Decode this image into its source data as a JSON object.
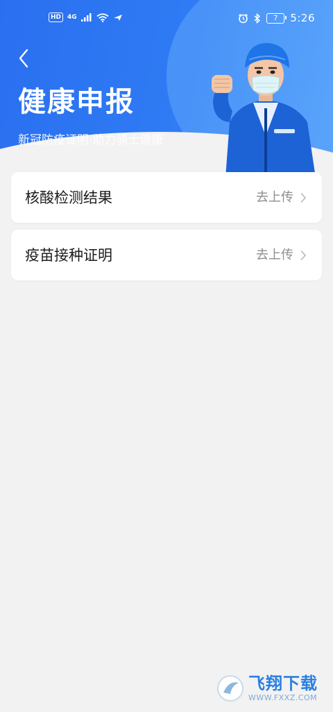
{
  "status_bar": {
    "hd": "HD",
    "network": "4G",
    "battery": "7",
    "time": "5:26"
  },
  "header": {
    "title": "健康申报",
    "subtitle": "新冠防疫证明·助力骑士健康"
  },
  "items": [
    {
      "label": "核酸检测结果",
      "action": "去上传"
    },
    {
      "label": "疫苗接种证明",
      "action": "去上传"
    }
  ],
  "watermark": {
    "cn": "飞翔下载",
    "en": "WWW.FXXZ.COM"
  },
  "colors": {
    "header_blue": "#2f7cf4",
    "background": "#f2f2f2",
    "card": "#ffffff",
    "muted_text": "#8e8e8e"
  }
}
